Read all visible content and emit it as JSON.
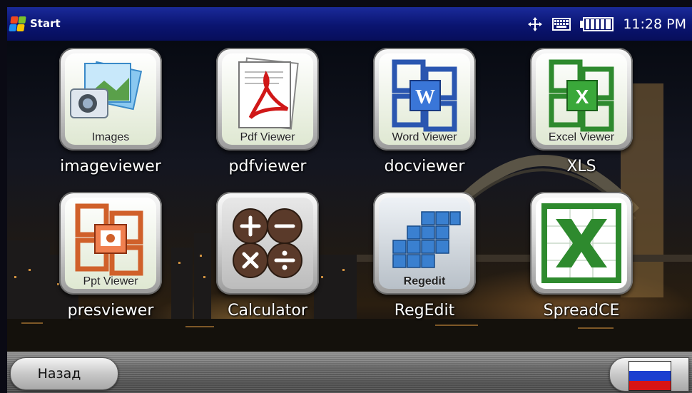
{
  "taskbar": {
    "start_label": "Start",
    "clock": "11:28 PM",
    "tray_icons": [
      "connectivity-icon",
      "keyboard-icon",
      "battery-icon"
    ]
  },
  "apps": [
    {
      "label": "imageviewer",
      "caption": "Images",
      "icon": "images-icon"
    },
    {
      "label": "pdfviewer",
      "caption": "Pdf Viewer",
      "icon": "pdf-icon"
    },
    {
      "label": "docviewer",
      "caption": "Word Viewer",
      "icon": "word-icon"
    },
    {
      "label": "XLS",
      "caption": "Excel Viewer",
      "icon": "excel-icon"
    },
    {
      "label": "presviewer",
      "caption": "Ppt Viewer",
      "icon": "powerpoint-icon"
    },
    {
      "label": "Calculator",
      "caption": "",
      "icon": "calculator-icon"
    },
    {
      "label": "RegEdit",
      "caption": "Regedit",
      "icon": "regedit-icon"
    },
    {
      "label": "SpreadCE",
      "caption": "",
      "icon": "spreadsheet-icon"
    }
  ],
  "bottombar": {
    "back_label": "Назад",
    "language_flag": "russia-flag-icon",
    "flag_colors": [
      "#ffffff",
      "#1c3fd0",
      "#d81414"
    ]
  }
}
